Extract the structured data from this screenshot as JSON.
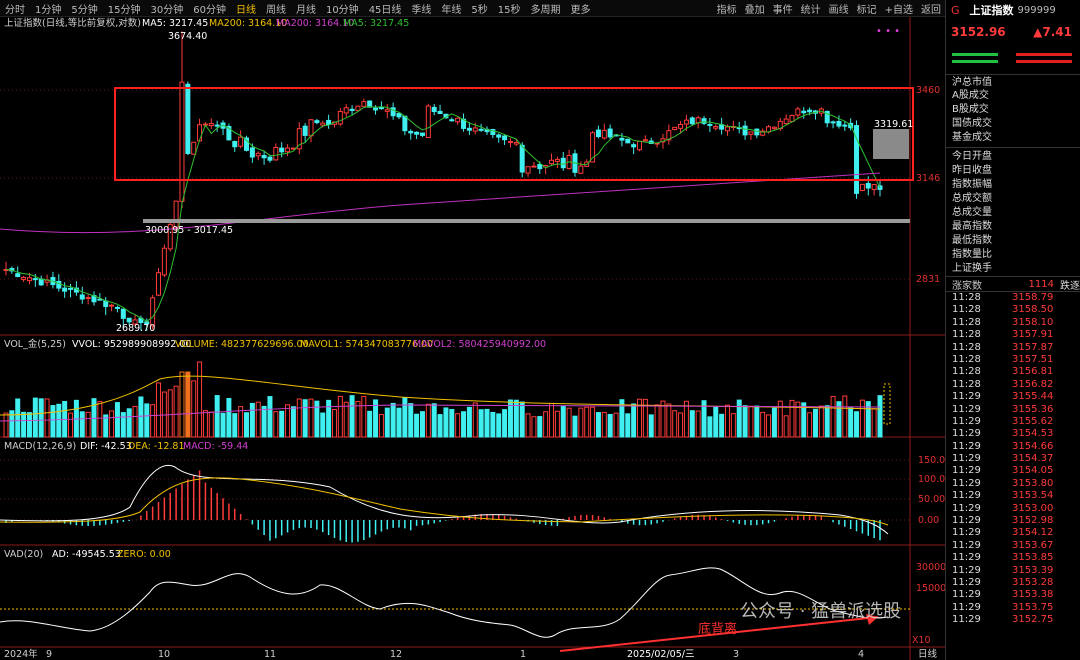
{
  "toolbar": {
    "timeframes": [
      "分时",
      "1分钟",
      "5分钟",
      "15分钟",
      "30分钟",
      "60分钟",
      "日线",
      "周线",
      "月线",
      "10分钟",
      "45日线",
      "季线",
      "年线",
      "5秒",
      "15秒",
      "多周期",
      "更多"
    ],
    "active_timeframe": "日线",
    "tools": [
      "指标",
      "叠加",
      "事件",
      "统计",
      "画线",
      "标记",
      "+自选",
      "返回"
    ]
  },
  "chart": {
    "title": "上证指数(日线,等比前复权,对数)",
    "ma_legend": [
      {
        "label": "MA5: 3217.45",
        "color": "#ffffff"
      },
      {
        "label": "MA200: 3164.10",
        "color": "#f0c000"
      },
      {
        "label": "MA200: 3164.10",
        "color": "#d040d0"
      },
      {
        "label": "MA5: 3217.45",
        "color": "#30c030"
      }
    ],
    "annotations": {
      "high": "3674.40",
      "low": "2689.70",
      "support_range": "3000.95 - 3017.45",
      "last_high": "3319.61"
    },
    "price_axis": [
      "3460",
      "3146",
      "2831"
    ],
    "vol_legend": {
      "name": "VOL_金(5,25)",
      "vvol": "VVOL: 952989908992.00",
      "volume": "VOLUME: 482377629696.00",
      "mavol1": "MAVOL1: 574347083776.00",
      "mavol2": "MAVOL2: 580425940992.00"
    },
    "macd_legend": {
      "name": "MACD(12,26,9)",
      "dif": "DIF: -42.53",
      "dea": "DEA: -12.81",
      "macd": "MACD: -59.44"
    },
    "macd_axis": [
      "150.0",
      "100.0",
      "50.00",
      "0.00"
    ],
    "vad_legend": {
      "name": "VAD(20)",
      "ad": "AD: -49545.53",
      "zero": "ZERO: 0.00"
    },
    "vad_axis": [
      "30000",
      "15000"
    ],
    "vad_scale": "X10",
    "note": "底背离",
    "dates": [
      "2024年",
      "9",
      "10",
      "11",
      "12",
      "1",
      "2025/02/05/三",
      "3",
      "4"
    ],
    "period_label": "日线",
    "colors": {
      "up": "#ff3b3b",
      "down": "#40f0f0",
      "box": "#ff2020",
      "ma5": "#30c030",
      "ma200": "#c030c0",
      "dif": "#ffffff",
      "dea": "#f0c000"
    }
  },
  "panel": {
    "badge": "G",
    "name": "上证指数",
    "code": "999999",
    "price": "3152.96",
    "change": "▲7.41",
    "market_head": "沪总市值",
    "market_items": [
      "A股成交",
      "B股成交",
      "国债成交",
      "基金成交"
    ],
    "stats": [
      "今日开盘",
      "昨日收盘",
      "指数振幅",
      "总成交额",
      "总成交量",
      "最高指数",
      "最低指数",
      "指数量比",
      "上证换手"
    ],
    "breadth_label": "涨家数",
    "breadth_value": "1114",
    "breadth_fall": "跌逐",
    "ticks": [
      {
        "t": "11:28",
        "p": "3158.79"
      },
      {
        "t": "11:28",
        "p": "3158.50"
      },
      {
        "t": "11:28",
        "p": "3158.10"
      },
      {
        "t": "11:28",
        "p": "3157.91"
      },
      {
        "t": "11:28",
        "p": "3157.87"
      },
      {
        "t": "11:28",
        "p": "3157.51"
      },
      {
        "t": "11:28",
        "p": "3156.81"
      },
      {
        "t": "11:28",
        "p": "3156.82"
      },
      {
        "t": "11:29",
        "p": "3155.44"
      },
      {
        "t": "11:29",
        "p": "3155.36"
      },
      {
        "t": "11:29",
        "p": "3155.62"
      },
      {
        "t": "11:29",
        "p": "3154.53"
      },
      {
        "t": "11:29",
        "p": "3154.66"
      },
      {
        "t": "11:29",
        "p": "3154.37"
      },
      {
        "t": "11:29",
        "p": "3154.05"
      },
      {
        "t": "11:29",
        "p": "3153.80"
      },
      {
        "t": "11:29",
        "p": "3153.54"
      },
      {
        "t": "11:29",
        "p": "3153.00"
      },
      {
        "t": "11:29",
        "p": "3152.98"
      },
      {
        "t": "11:29",
        "p": "3154.12"
      },
      {
        "t": "11:29",
        "p": "3153.67"
      },
      {
        "t": "11:29",
        "p": "3153.85"
      },
      {
        "t": "11:29",
        "p": "3153.39"
      },
      {
        "t": "11:29",
        "p": "3153.28"
      },
      {
        "t": "11:29",
        "p": "3153.38"
      },
      {
        "t": "11:29",
        "p": "3153.75"
      },
      {
        "t": "11:29",
        "p": "3152.75"
      }
    ]
  },
  "watermark": "公众号 · 猛兽派选股"
}
